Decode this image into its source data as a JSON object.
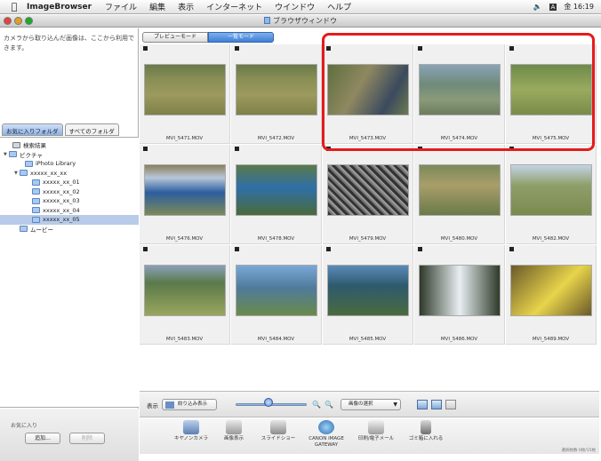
{
  "menubar": {
    "app_name": "ImageBrowser",
    "menus": [
      "ファイル",
      "編集",
      "表示",
      "インターネット",
      "ウインドウ",
      "ヘルプ"
    ],
    "clock": "金 16:19"
  },
  "window": {
    "title": "ブラウザウィンドウ"
  },
  "left_pane": {
    "info_text": "カメラから取り込んだ画像は、ここから利用できます。",
    "folder_tabs": [
      "お気に入りフォルダ",
      "すべてのフォルダ"
    ],
    "tree": [
      {
        "label": "検索結果"
      },
      {
        "label": "ピクチャ"
      },
      {
        "label": "iPhoto Library"
      },
      {
        "label": "xxxxx_xx_xx"
      },
      {
        "label": "xxxxx_xx_01"
      },
      {
        "label": "xxxxx_xx_02"
      },
      {
        "label": "xxxxx_xx_03"
      },
      {
        "label": "xxxxx_xx_04"
      },
      {
        "label": "xxxxx_xx_05"
      },
      {
        "label": "ムービー"
      }
    ],
    "favorites_label": "お気に入り",
    "add_button": "追加...",
    "delete_button": "削除"
  },
  "mode_tabs": [
    "プレビューモード",
    "一覧モード"
  ],
  "items": [
    {
      "name": "MVI_5471.MOV",
      "scene": "grass"
    },
    {
      "name": "MVI_5472.MOV",
      "scene": "grass"
    },
    {
      "name": "MVI_5473.MOV",
      "scene": "deer-close"
    },
    {
      "name": "MVI_5474.MOV",
      "scene": "deer-stream"
    },
    {
      "name": "MVI_5475.MOV",
      "scene": "deer-walk"
    },
    {
      "name": "MVI_5476.MOV",
      "scene": "river"
    },
    {
      "name": "MVI_5478.MOV",
      "scene": "river2"
    },
    {
      "name": "MVI_5479.MOV",
      "scene": "rocks"
    },
    {
      "name": "MVI_5480.MOV",
      "scene": "field"
    },
    {
      "name": "MVI_5482.MOV",
      "scene": "field2"
    },
    {
      "name": "MVI_5483.MOV",
      "scene": "geese"
    },
    {
      "name": "MVI_5484.MOV",
      "scene": "river3"
    },
    {
      "name": "MVI_5485.MOV",
      "scene": "forest-river"
    },
    {
      "name": "MVI_5486.MOV",
      "scene": "waterfall"
    },
    {
      "name": "MVI_5489.MOV",
      "scene": "yellow"
    }
  ],
  "controls": {
    "display_label": "表示",
    "sort_button": "絞り込み表示",
    "select_label": "画像の選択"
  },
  "toolbar": [
    {
      "label": "キヤノンカメラ"
    },
    {
      "label": "画像表示"
    },
    {
      "label": "スライドショー"
    },
    {
      "label": "CANON iMAGE GATEWAY"
    },
    {
      "label": "印刷/電子メール"
    },
    {
      "label": "ゴミ箱に入れる"
    }
  ],
  "status_text": "選択枚数 0枚/15枚"
}
